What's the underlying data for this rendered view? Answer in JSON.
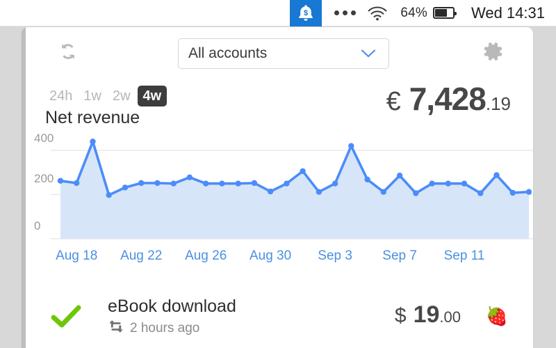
{
  "status_bar": {
    "notification_icon": "bell-dollar-icon",
    "menu_icon": "three-dots-icon",
    "wifi_icon": "wifi-icon",
    "battery_percent": "64%",
    "battery_icon": "battery-icon",
    "clock": "Wed 14:31"
  },
  "toolbar": {
    "refresh_icon": "refresh-icon",
    "gear_icon": "gear-icon",
    "chevron_icon": "chevron-down-icon",
    "account_selected": "All accounts",
    "account_options": [
      "All accounts"
    ]
  },
  "metric": {
    "ranges": [
      {
        "label": "24h",
        "active": false
      },
      {
        "label": "1w",
        "active": false
      },
      {
        "label": "2w",
        "active": false
      },
      {
        "label": "4w",
        "active": true
      }
    ],
    "label": "Net revenue",
    "currency": "€",
    "major": "7,428",
    "minor": ".19"
  },
  "transaction": {
    "status_icon": "green-check-icon",
    "recurring_icon": "recurring-arrows-icon",
    "title": "eBook download",
    "time": "2 hours ago",
    "currency": "$",
    "major": "19",
    "minor": ".00",
    "emoji": "🍓"
  },
  "colors": {
    "accent_blue": "#4a90e2",
    "line_blue": "#4b8df8",
    "area_blue": "#d7e5f8",
    "badge_blue": "#1878d4",
    "check_green": "#6ec60a",
    "active_pill": "#3d3d3d"
  },
  "chart_data": {
    "type": "area",
    "title": "Net revenue",
    "xlabel": "",
    "ylabel": "",
    "ylim": [
      0,
      460
    ],
    "yticks": [
      0,
      200,
      400
    ],
    "grid": true,
    "legend": false,
    "x_tick_labels": [
      "Aug 18",
      "Aug 22",
      "Aug 26",
      "Aug 30",
      "Sep 3",
      "Sep 7",
      "Sep 11"
    ],
    "x_tick_indices": [
      1,
      5,
      9,
      13,
      17,
      21,
      25
    ],
    "series": [
      {
        "name": "Net revenue",
        "values": [
          262,
          252,
          440,
          198,
          232,
          252,
          252,
          250,
          278,
          250,
          250,
          250,
          252,
          214,
          250,
          306,
          212,
          250,
          420,
          268,
          212,
          286,
          206,
          250,
          250,
          250,
          206,
          288,
          208,
          212
        ]
      }
    ]
  }
}
